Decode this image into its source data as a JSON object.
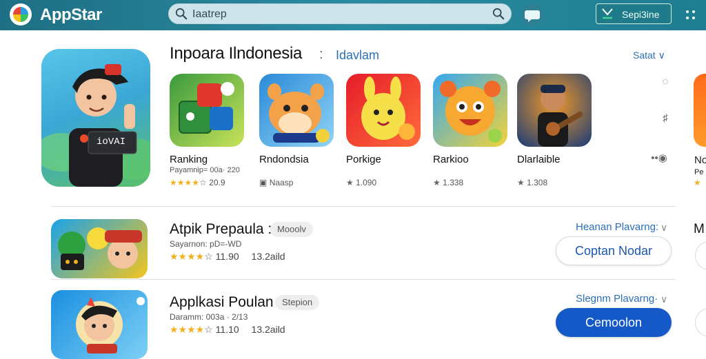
{
  "header": {
    "brand": "AppStar",
    "search_value": "Iaatrep",
    "signin_label": "Sepi3ine"
  },
  "featured": {
    "title": "Inpoara Ilndonesia",
    "separator": ":",
    "subtitle": "Idavlam",
    "see_all": "Satat",
    "apps": [
      {
        "name": "Ranking",
        "sub": "Payamnip= 00a· 220",
        "rating": "20.9",
        "stars": 4,
        "colors": [
          "#3a9a3e",
          "#c8e35a"
        ]
      },
      {
        "name": "Rndondsia",
        "sub": "",
        "rating": "Naasp",
        "stars": 0,
        "colors": [
          "#2b8ad8",
          "#8fd3f5"
        ]
      },
      {
        "name": "Porkige",
        "sub": "",
        "rating": "1.090",
        "stars": 1,
        "colors": [
          "#e51c2a",
          "#ff6b3a"
        ]
      },
      {
        "name": "Rarkioo",
        "sub": "",
        "rating": "1.338",
        "stars": 1,
        "colors": [
          "#35a8f0",
          "#f2d33a"
        ]
      },
      {
        "name": "Dlarlaible",
        "sub": "",
        "rating": "1.308",
        "stars": 1,
        "colors": [
          "#f29a26",
          "#173a78"
        ]
      }
    ],
    "edge_name": "No",
    "edge_sub": "Pe"
  },
  "list": [
    {
      "title": "Atpik Prepaula :",
      "badge": "Mooolv",
      "sub": "Sayarnon: pD=-WD",
      "rating": "11.90",
      "size": "13.2aild",
      "meta": "Heanan Plavarng:",
      "button": "Coptan Nodar",
      "button_style": "outline",
      "edge_letter": "M"
    },
    {
      "title": "Applkasi Poulan :",
      "badge": "Stepion",
      "sub": "Daramm: 003a · 2/13",
      "rating": "11.10",
      "size": "13.2aild",
      "meta": "Slegnm Plavarng·",
      "button": "Cemoolon",
      "button_style": "solid",
      "edge_letter": ""
    }
  ],
  "hero": {
    "shirt_text": "ioVAI"
  },
  "colors": {
    "topbar": "#1e6f84",
    "accent": "#1559c9",
    "link": "#2a6fb6",
    "star": "#f2b01e"
  }
}
